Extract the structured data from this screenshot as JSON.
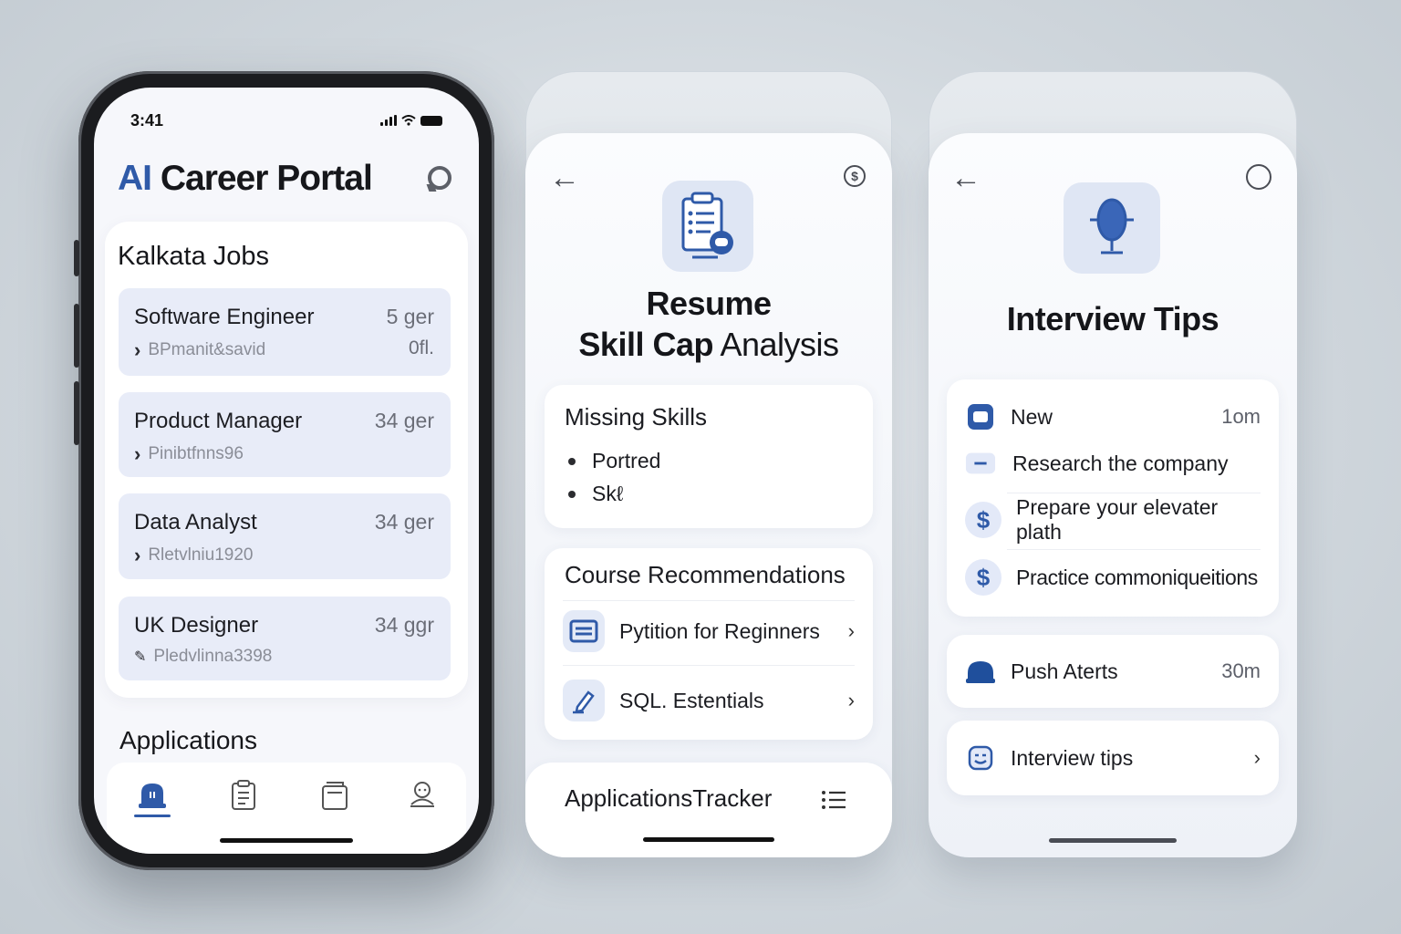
{
  "phone1": {
    "status": {
      "time": "3:41"
    },
    "title_ai": "AI",
    "title_rest": " Career Portal",
    "jobs_title": "Kalkata Jobs",
    "jobs": [
      {
        "title": "Software Engineer",
        "meta": "5 ger",
        "sub": "BPmanit&savid",
        "meta2": "0fl.",
        "sub_icon": "chevron-right-icon"
      },
      {
        "title": "Product Manager",
        "meta": "34 ger",
        "sub": "Pinibtfnns96",
        "meta2": "",
        "sub_icon": "chevron-right-icon"
      },
      {
        "title": "Data Analyst",
        "meta": "34 ger",
        "sub": "Rletvlniu1920",
        "meta2": "",
        "sub_icon": "chevron-right-icon"
      },
      {
        "title": "UK Designer",
        "meta": "34 ggr",
        "sub": "Pledvlinna3398",
        "meta2": "",
        "sub_icon": "pencil-icon"
      }
    ],
    "applications_label": "Applications",
    "tabs": [
      "jobs-badge-icon",
      "document-icon",
      "folder-icon",
      "profile-icon"
    ]
  },
  "phone2": {
    "title_line1": "Resume",
    "title_line2_bold": "Skill  Cap",
    "title_line2_light": " Analysis",
    "missing_title": "Missing Skills",
    "missing_items": [
      "Portred",
      "Skℓ"
    ],
    "courses_title": "Course Recommendations",
    "courses": [
      {
        "label": "Pytition for Reginners",
        "icon": "book-icon"
      },
      {
        "label": "SQL. Estentials",
        "icon": "pencil-icon"
      }
    ],
    "tracker_label": "ApplicationsTracker"
  },
  "phone3": {
    "title": "Interview Tips",
    "tips_new_label": "New",
    "tips_new_meta": "1om",
    "tips": [
      {
        "label": "Research the company",
        "icon": "minus-icon"
      },
      {
        "label": "Prepare your elevater plath",
        "icon": "dollar-icon"
      },
      {
        "label": "Practice commoniqueitions",
        "icon": "dollar-icon"
      }
    ],
    "push_label": "Push Aterts",
    "push_meta": "30m",
    "interview_label": "Interview tips"
  },
  "colors": {
    "accent": "#2f5aa8",
    "row_bg": "#e8ecf8"
  }
}
